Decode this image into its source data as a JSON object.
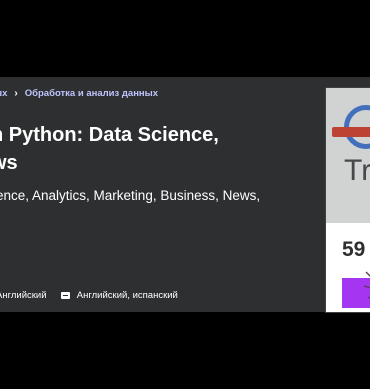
{
  "breadcrumbs": {
    "first": "ых",
    "second": "Обработка и анализ данных"
  },
  "course": {
    "title_line1": "h Python: Data Science,",
    "title_line2": "ws",
    "subtitle_line1": "ence, Analytics, Marketing, Business, News,",
    "audio_language": "Английский",
    "caption_languages": "Английский, испанский"
  },
  "card": {
    "preview_text": "Tr",
    "price": "59"
  },
  "colors": {
    "hero_bg": "#2d2f31",
    "breadcrumb": "#c0c4fc",
    "buy_button": "#a435f0"
  }
}
